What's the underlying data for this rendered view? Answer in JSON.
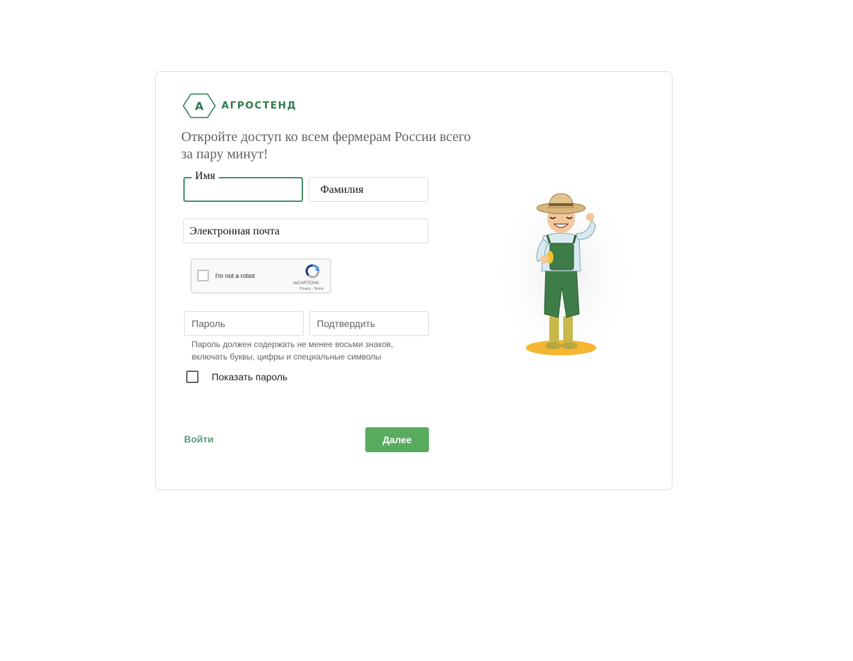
{
  "brand": {
    "name": "АГРОСТЕНД",
    "letter": "А",
    "color": "#2e7d4f"
  },
  "headline": "Откройте доступ ко всем фермерам России всего за пару минут!",
  "form": {
    "first_name_label": "Имя",
    "last_name_label": "Фамилия",
    "email_label": "Электронная почта",
    "password_placeholder": "Пароль",
    "confirm_placeholder": "Подтвердить",
    "password_hint": "Пароль должен содержать не менее восьми знаков, включать буквы, цифры и специальные символы",
    "show_password_label": "Показать пароль"
  },
  "recaptcha": {
    "label": "I'm not a robot",
    "brand": "reCAPTCHA",
    "terms": "Privacy - Terms"
  },
  "actions": {
    "signin_label": "Войти",
    "next_label": "Далее",
    "accent": "#58ab5f"
  },
  "illustration": {
    "icon": "farmer-illustration"
  }
}
